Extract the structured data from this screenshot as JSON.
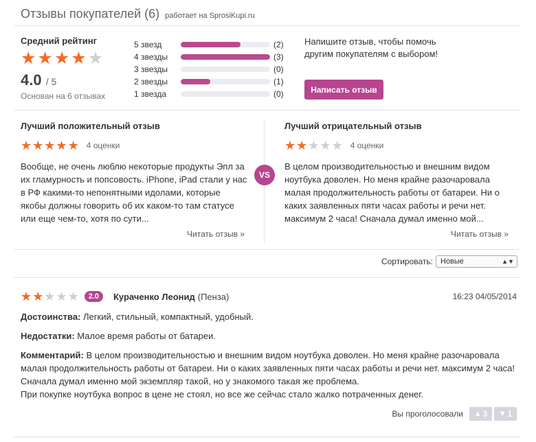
{
  "header": {
    "title": "Отзывы покупателей (6)",
    "powered_prefix": "работает на",
    "powered_link": "SprosiKupi.ru"
  },
  "summary": {
    "label": "Средний рейтинг",
    "stars_filled": 4,
    "stars_total": 5,
    "score": "4.0",
    "score_of": "/ 5",
    "based_on": "Основан на 6 отзывах"
  },
  "distribution": [
    {
      "label": "5 звезд",
      "count": "(2)",
      "fraction": 0.6667
    },
    {
      "label": "4 звезды",
      "count": "(3)",
      "fraction": 1.0
    },
    {
      "label": "3 звезды",
      "count": "(0)",
      "fraction": 0.0
    },
    {
      "label": "2 звезды",
      "count": "(1)",
      "fraction": 0.3333
    },
    {
      "label": "1 звезда",
      "count": "(0)",
      "fraction": 0.0
    }
  ],
  "cta": {
    "text": "Напишите отзыв, чтобы помочь другим покупателям с выбором!",
    "button_label": "Написать отзыв"
  },
  "best_positive": {
    "title": "Лучший положительный отзыв",
    "stars_filled": 5,
    "votes": "4 оценки",
    "text": "Вообще, не очень люблю некоторые продукты Эпл за их гламурность и попсовость. iPhone, iPad стали у нас в РФ какими-то непонятными идолами, которые якобы должны говорить об их каком-то там статусе или еще чем-то, хотя по сути...",
    "more": "Читать отзыв »"
  },
  "vs_label": "VS",
  "best_negative": {
    "title": "Лучший отрицательный отзыв",
    "stars_filled": 2,
    "votes": "4 оценки",
    "text": "В целом производительностью и внешним видом ноутбука доволен. Но меня крайне разочаровала малая продолжительность работы от батареи. Ни о каких заявленных пяти часах работы и речи нет. максимум 2 часа! Сначала думал именно мой...",
    "more": "Читать отзыв »"
  },
  "sort": {
    "label": "Сортировать:",
    "selected": "Новые"
  },
  "review": {
    "stars_filled": 2,
    "rating_badge": "2.0",
    "author": "Кураченко Леонид",
    "city": "(Пенза)",
    "date": "16:23 04/05/2014",
    "pros_label": "Достоинства:",
    "pros": "Легкий, стильный, компактный, удобный.",
    "cons_label": "Недостатки:",
    "cons": "Малое время работы от батареи.",
    "comment_label": "Комментарий:",
    "comment": "В целом производительностью и внешним видом ноутбука доволен. Но меня крайне разочаровала малая продолжительность работы от батареи. Ни о каких заявленных пяти часах работы и речи нет. максимум 2 часа! Сначала думал именно мой экземпляр такой, но у знакомого такая же проблема.",
    "comment2": "При покупке ноутбука вопрос в цене не стоял, но все же сейчас стало жалко потраченных денег.",
    "voted_label": "Вы проголосовали",
    "up_count": "3",
    "down_count": "1"
  },
  "icons": {
    "star": "star-icon",
    "thumb_up": "thumbs-up-icon",
    "thumb_down": "thumbs-down-icon",
    "select_arrow": "chevron-updown-icon"
  },
  "colors": {
    "accent": "#b7458f",
    "star_on": "#f36b22",
    "star_off": "#cfcfcf",
    "bar_bg": "#eaecf0",
    "vote_bg": "#d3d6dc"
  }
}
